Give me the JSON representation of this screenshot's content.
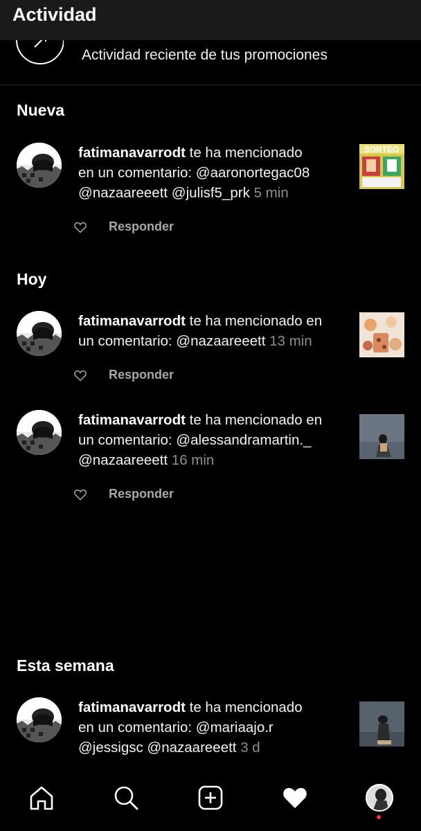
{
  "header": {
    "title": "Actividad"
  },
  "promo": {
    "label": "Actividad reciente de tus promociones"
  },
  "sections": {
    "nueva": "Nueva",
    "hoy": "Hoy",
    "semana": "Esta semana"
  },
  "reply_label": "Responder",
  "items": [
    {
      "user": "fatimanavarrodt",
      "line1": " te ha mencionado",
      "line2": "en un comentario: @aaronortegac08",
      "line3": "@nazaareeett @julisf5_prk",
      "time": " 5 min",
      "thumb": "sorteo-image"
    },
    {
      "user": "fatimanavarrodt",
      "line1": " te ha mencionado en",
      "line2": "un comentario: @nazaareeett",
      "time": " 13 min",
      "thumb": "products-image"
    },
    {
      "user": "fatimanavarrodt",
      "line1": " te ha mencionado en",
      "line2": "un comentario: @alessandramartin._",
      "line3": "@nazaareeett",
      "time": " 16 min",
      "thumb": "girl-sitting-image"
    },
    {
      "user": "fatimanavarrodt",
      "line1": " te ha mencionado",
      "line2": "en un comentario: @mariaajo.r",
      "line3": "@jessigsc @nazaareeett",
      "time": " 3 d",
      "thumb": "person-dark-image"
    }
  ],
  "nav": [
    "home-icon",
    "search-icon",
    "new-post-icon",
    "activity-heart-icon",
    "profile-avatar"
  ],
  "colors": {
    "background": "#000000",
    "header": "#1a1a1a",
    "muted": "#8e8e8e",
    "badge": "#ff3040"
  }
}
